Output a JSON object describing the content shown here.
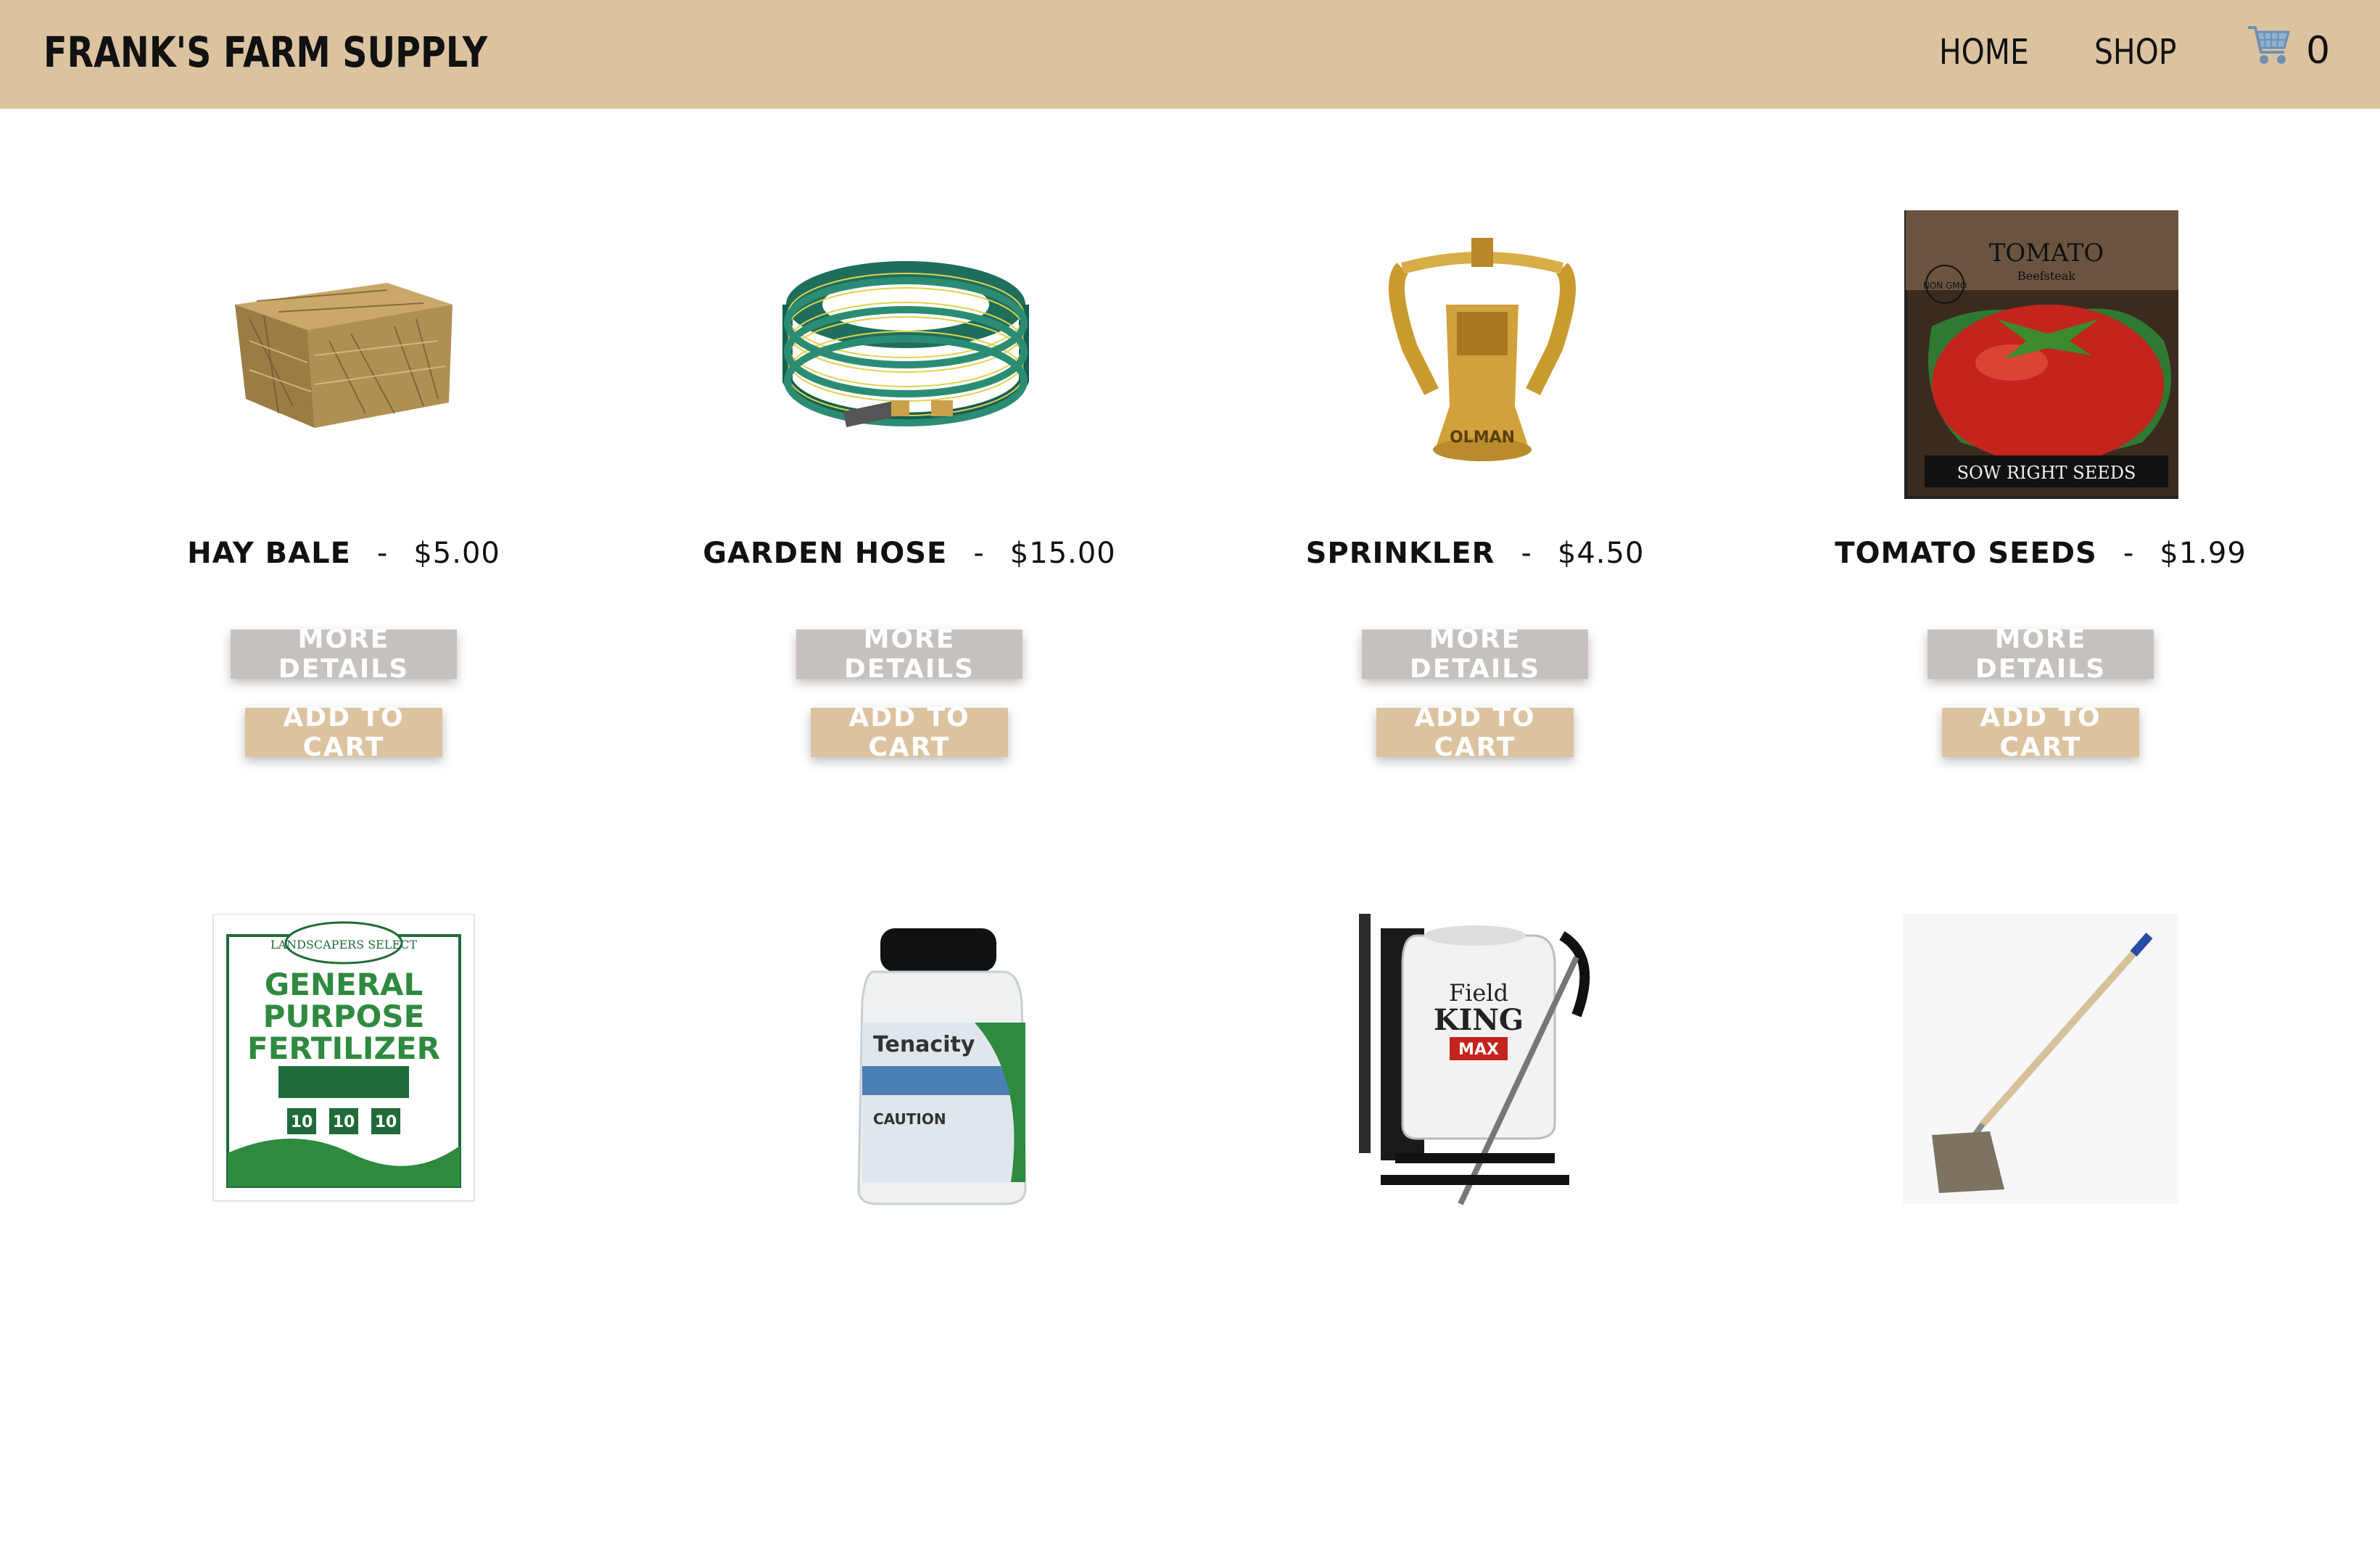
{
  "header": {
    "brand": "FRANK'S FARM SUPPLY",
    "nav": {
      "home": "HOME",
      "shop": "SHOP"
    },
    "cart": {
      "icon": "shopping-cart-icon",
      "count": "0"
    },
    "color": "#dcc3a0"
  },
  "buttons": {
    "details_label": "MORE DETAILS",
    "cart_label": "ADD TO CART"
  },
  "colors": {
    "details_button": "#c6c1bf",
    "cart_button": "#dcc3a0"
  },
  "products": [
    {
      "name": "HAY BALE",
      "price": "$5.00",
      "image": "hay-bale-image"
    },
    {
      "name": "GARDEN HOSE",
      "price": "$15.00",
      "image": "garden-hose-image"
    },
    {
      "name": "SPRINKLER",
      "price": "$4.50",
      "image": "sprinkler-image"
    },
    {
      "name": "TOMATO SEEDS",
      "price": "$1.99",
      "image": "tomato-seeds-image",
      "image_text": {
        "title": "TOMATO",
        "subtitle": "Beefsteak",
        "badge": "NON GMO",
        "brand": "SOW RIGHT SEEDS"
      }
    },
    {
      "name": "",
      "price": "",
      "image": "fertilizer-bag-image",
      "image_text": {
        "brand": "LANDSCAPERS SELECT",
        "title_1": "GENERAL",
        "title_2": "PURPOSE",
        "title_3": "FERTILIZER",
        "npk": [
          "10",
          "10",
          "10"
        ]
      }
    },
    {
      "name": "",
      "price": "",
      "image": "herbicide-bottle-image",
      "image_text": {
        "brand": "Tenacity",
        "warning": "CAUTION"
      }
    },
    {
      "name": "",
      "price": "",
      "image": "backpack-sprayer-image",
      "image_text": {
        "brand_1": "Field",
        "brand_2": "KING",
        "model": "MAX"
      }
    },
    {
      "name": "",
      "price": "",
      "image": "garden-hoe-image"
    }
  ]
}
